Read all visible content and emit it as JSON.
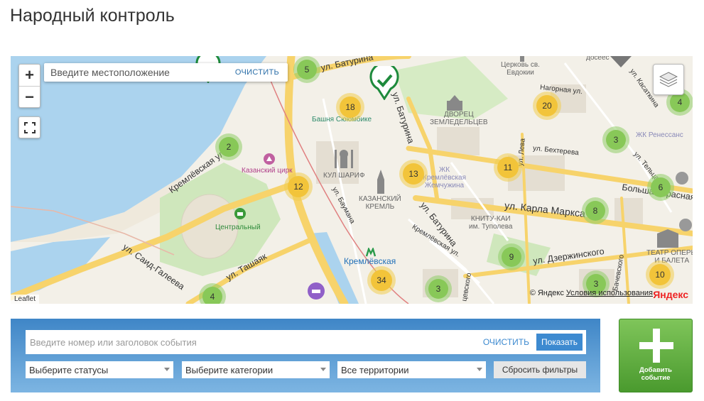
{
  "page": {
    "title": "Народный контроль"
  },
  "map": {
    "zoom_in": "+",
    "zoom_out": "−",
    "location": {
      "placeholder": "Введите местоположение",
      "clear": "ОЧИСТИТЬ"
    },
    "clusters": [
      {
        "count": "5",
        "color": "green"
      },
      {
        "count": "18",
        "color": "yellow"
      },
      {
        "count": "20",
        "color": "yellow"
      },
      {
        "count": "4",
        "color": "green"
      },
      {
        "count": "2",
        "color": "green"
      },
      {
        "count": "12",
        "color": "yellow"
      },
      {
        "count": "13",
        "color": "yellow"
      },
      {
        "count": "11",
        "color": "yellow"
      },
      {
        "count": "3",
        "color": "green"
      },
      {
        "count": "6",
        "color": "green"
      },
      {
        "count": "8",
        "color": "green"
      },
      {
        "count": "9",
        "color": "green"
      },
      {
        "count": "3",
        "color": "green"
      },
      {
        "count": "10",
        "color": "yellow"
      },
      {
        "count": "34",
        "color": "yellow"
      },
      {
        "count": "3",
        "color": "green"
      },
      {
        "count": "4",
        "color": "green"
      }
    ],
    "streets": {
      "baturina1": "ул. Батурина",
      "baturina2": "ул. Батурина",
      "baturina3": "ул. Батурина",
      "kremlevskaya": "Кремлёвская ул.",
      "kremlevskaya2": "Кремлёвская ул.",
      "said_galeeva": "ул. Саид-Галеева",
      "tashayak": "ул. Ташаяк",
      "baumana": "ул. Баумана",
      "karla_marksa": "ул. Карла Маркса",
      "bolshaya_krasnaya": "Большая Красная",
      "dzerzhinskogo": "ул. Дзержинского",
      "bekhtereva": "ул. Бехтерева",
      "nagornaya": "Нагорная ул.",
      "kasatkina": "ул. Касаткина",
      "teltsa": "ул. Тельца",
      "bachevskogo": "Бачевского",
      "lueva": "ул. Лева",
      "cheshevskogo": "цевского",
      "ogo": "ого"
    },
    "pois": {
      "tower": "Башня Сююмбике",
      "circus": "Казанский цирк",
      "stadium": "Центральный",
      "kul_sharif": "КУЛ ШАРИФ",
      "kremlin": "КАЗАНСКИЙ\nКРЕМЛЬ",
      "church": "Церковь св.\nЕвдокии",
      "palace": "ДВОРЕЦ\nЗЕМЛЕДЕЛЬЦЕВ",
      "zhk_pearl": "ЖК\nКремлёвская\nЖемчужина",
      "kai": "КНИТУ-КАИ\nим. Туполева",
      "theatre": "ТЕАТР ОПЕРЫ\nИ БАЛЕТА",
      "metro": "Кремлёвская",
      "zhk_renaissance": "ЖК Ренессанс",
      "dosees": "досеес"
    },
    "leaflet": "Leaflet",
    "yandex_copy": "© Яндекс",
    "yandex_terms": "Условия использования",
    "yandex_logo": "Яндекс"
  },
  "filter": {
    "search_placeholder": "Введите номер или заголовок события",
    "clear": "ОЧИСТИТЬ",
    "show": "Показать",
    "statuses": "Выберите статусы",
    "categories": "Выберите категории",
    "territories": "Все территории",
    "reset": "Сбросить фильтры"
  },
  "add_button": {
    "label": "Добавить событие"
  },
  "colors": {
    "accent": "#3d8ad0",
    "green": "#88c858",
    "yellow": "#f2c43a",
    "water": "#abd3ee",
    "road": "#f7d36b"
  }
}
